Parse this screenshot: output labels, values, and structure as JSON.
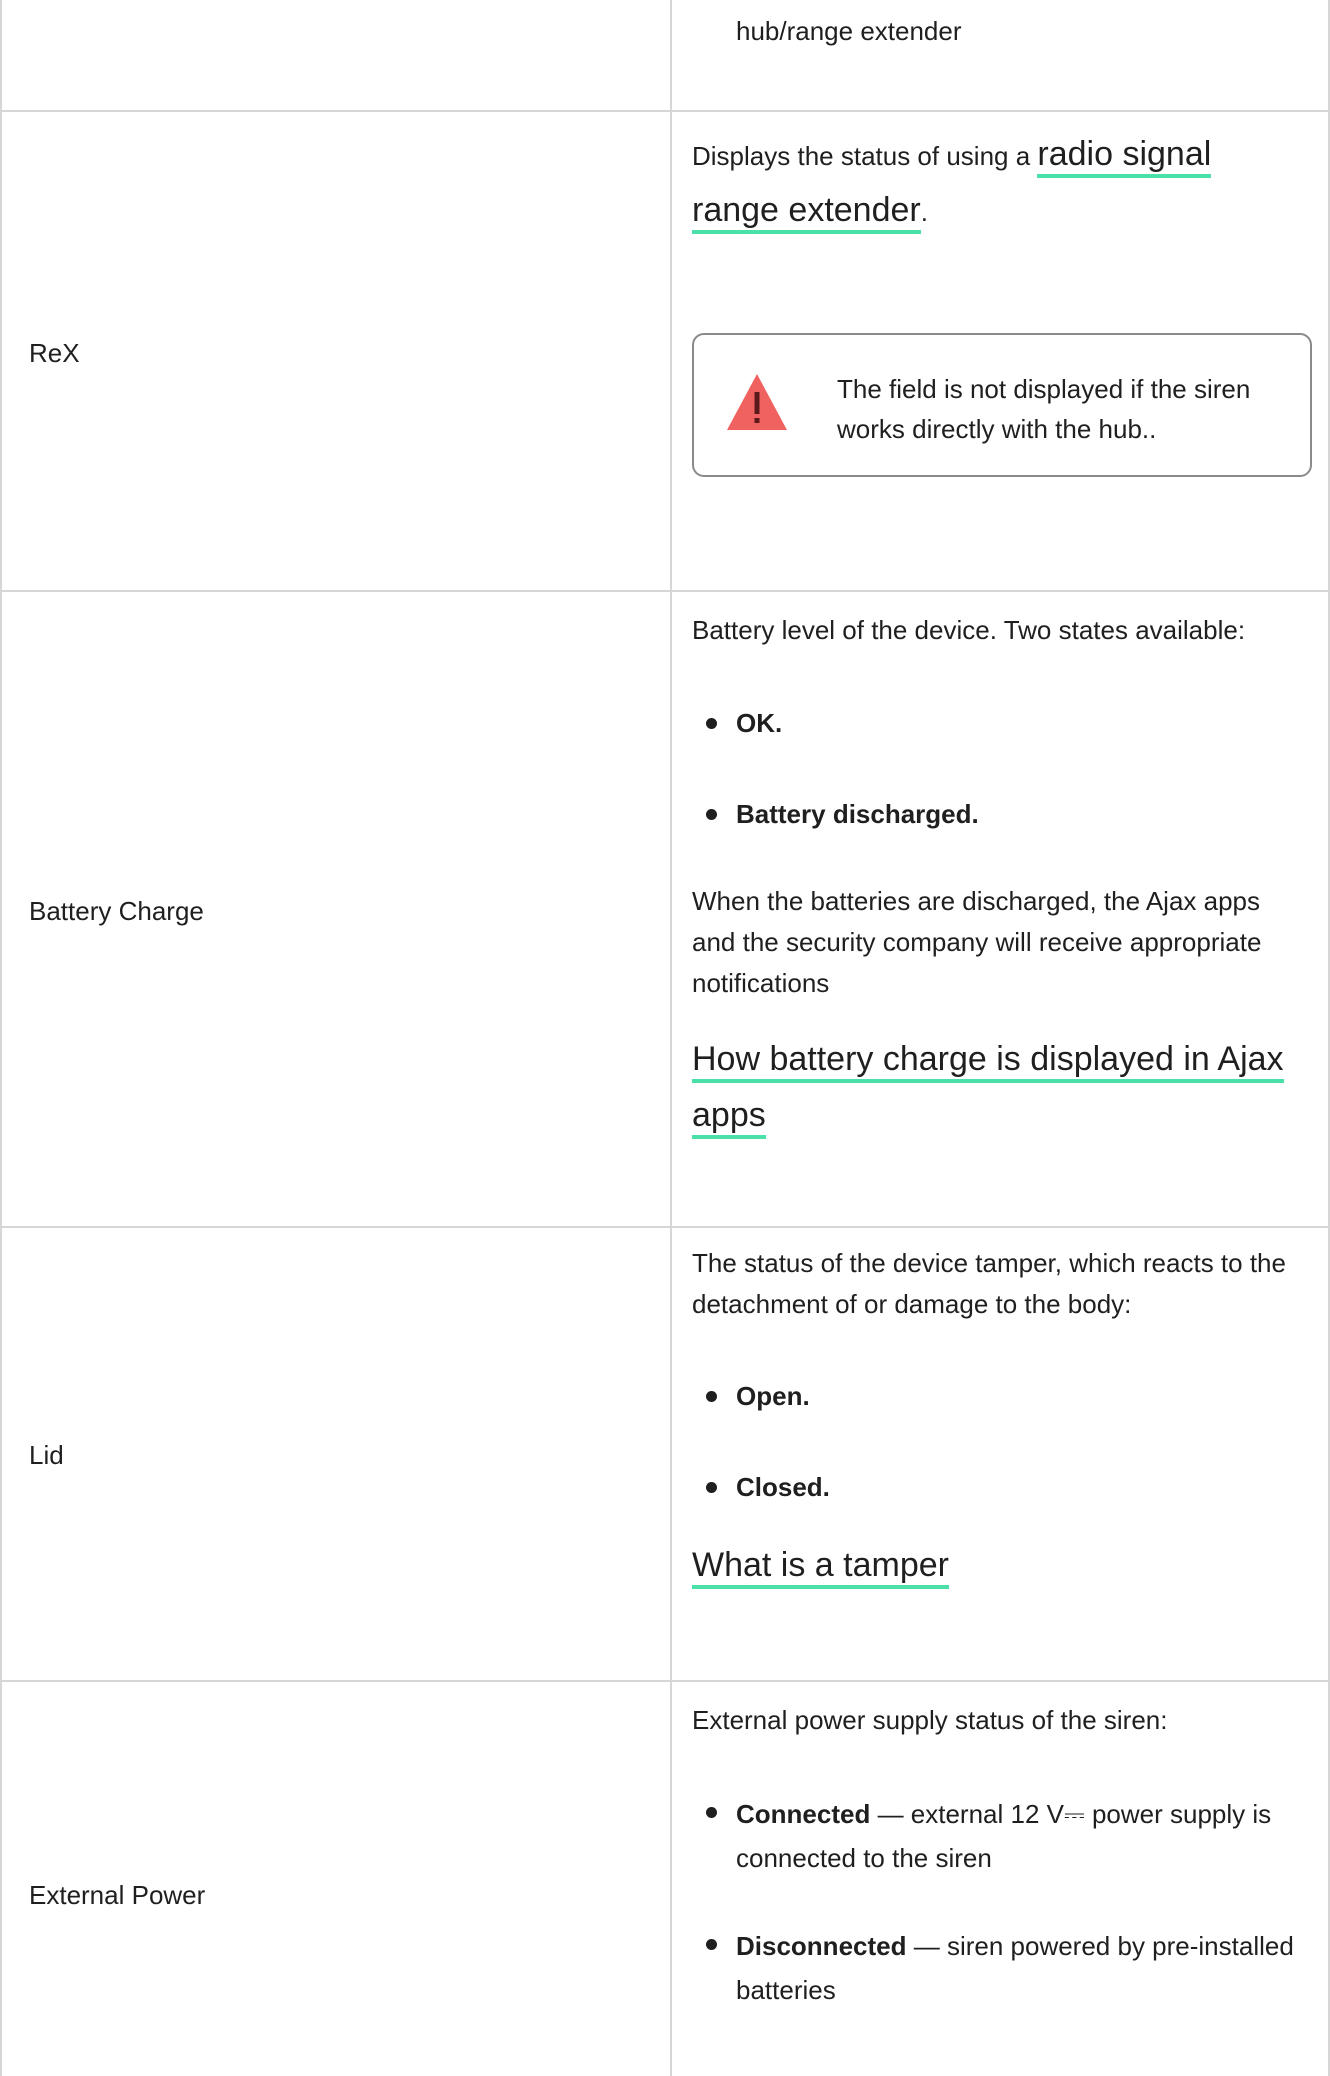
{
  "row0": {
    "right_text": "hub/range extender"
  },
  "rex": {
    "label": "ReX",
    "desc_prefix": "Displays the status of using a ",
    "link": "radio signal range extender",
    "desc_suffix": ".",
    "warning": "The field is not displayed if the siren works directly with the hub.."
  },
  "battery": {
    "label": "Battery Charge",
    "intro": "Battery level of the device. Two states available:",
    "states": [
      "OK.",
      "Battery discharged."
    ],
    "note": "When the batteries are discharged, the Ajax apps and the security company will receive appropriate notifications",
    "link": "How battery charge is displayed in Ajax apps"
  },
  "lid": {
    "label": "Lid",
    "intro": "The status of the device tamper, which reacts to the detachment of or damage to the body:",
    "states": [
      "Open.",
      "Closed."
    ],
    "link": "What is a tamper"
  },
  "power": {
    "label": "External Power",
    "intro": "External power supply status of the siren:",
    "states": [
      {
        "term": "Connected",
        "desc": " — external 12 V⎓ power supply is connected to the siren"
      },
      {
        "term": "Disconnected",
        "desc": " — siren powered by pre-installed batteries"
      }
    ]
  },
  "colors": {
    "link_underline": "#4be0a8",
    "warning_icon": "#f0625f",
    "border": "#d6d6d6"
  }
}
